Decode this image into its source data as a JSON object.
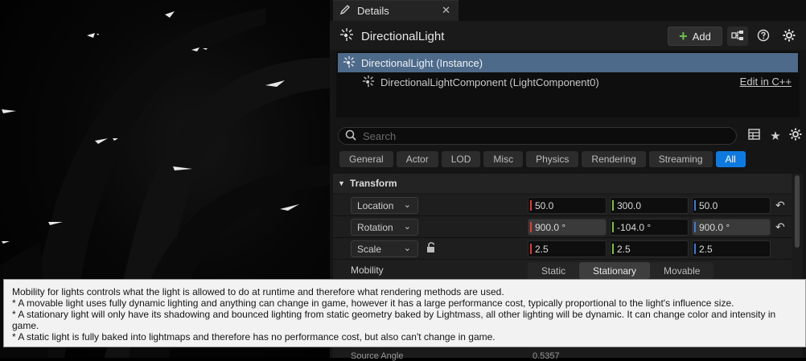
{
  "details_tab": {
    "title": "Details",
    "close": "✕"
  },
  "header": {
    "actor_name": "DirectionalLight",
    "add_label": "Add"
  },
  "tree": {
    "instance": "DirectionalLight (Instance)",
    "component": "DirectionalLightComponent (LightComponent0)",
    "edit_link": "Edit in C++"
  },
  "search": {
    "placeholder": "Search"
  },
  "filters": [
    "General",
    "Actor",
    "LOD",
    "Misc",
    "Physics",
    "Rendering",
    "Streaming",
    "All"
  ],
  "active_filter": "All",
  "transform": {
    "section": "Transform",
    "location": {
      "label": "Location",
      "x": "50.0",
      "y": "300.0",
      "z": "50.0"
    },
    "rotation": {
      "label": "Rotation",
      "x": "900.0 °",
      "y": "-104.0 °",
      "z": "900.0 °"
    },
    "scale": {
      "label": "Scale",
      "x": "2.5",
      "y": "2.5",
      "z": "2.5"
    },
    "mobility": {
      "label": "Mobility",
      "options": [
        "Static",
        "Stationary",
        "Movable"
      ],
      "selected": "Stationary"
    }
  },
  "tooltip": {
    "line1": "Mobility for lights controls what the light is allowed to do at runtime and therefore what rendering methods are used.",
    "line2": "* A movable light uses fully dynamic lighting and anything can change in game, however it has a large performance cost, typically proportional to the light's influence size.",
    "line3": "* A stationary light will only have its shadowing and bounced lighting from static geometry baked by Lightmass, all other lighting will be dynamic.  It can change color and intensity in game.",
    "line4": "* A static light is fully baked into lightmaps and therefore has no performance cost, but also can't change in game."
  },
  "partial_row": {
    "label": "Source Angle",
    "value": "0.5357"
  },
  "colors": {
    "accent": "#0e7ae0",
    "selection": "#4d6a8a",
    "add_plus": "#6bc24a"
  },
  "icons": [
    "light-icon",
    "plus-icon",
    "blueprint-icon",
    "help-icon",
    "settings-icon",
    "search-icon",
    "table-view-icon",
    "star-icon",
    "lock-icon",
    "reset-icon",
    "chevron-down-icon"
  ]
}
